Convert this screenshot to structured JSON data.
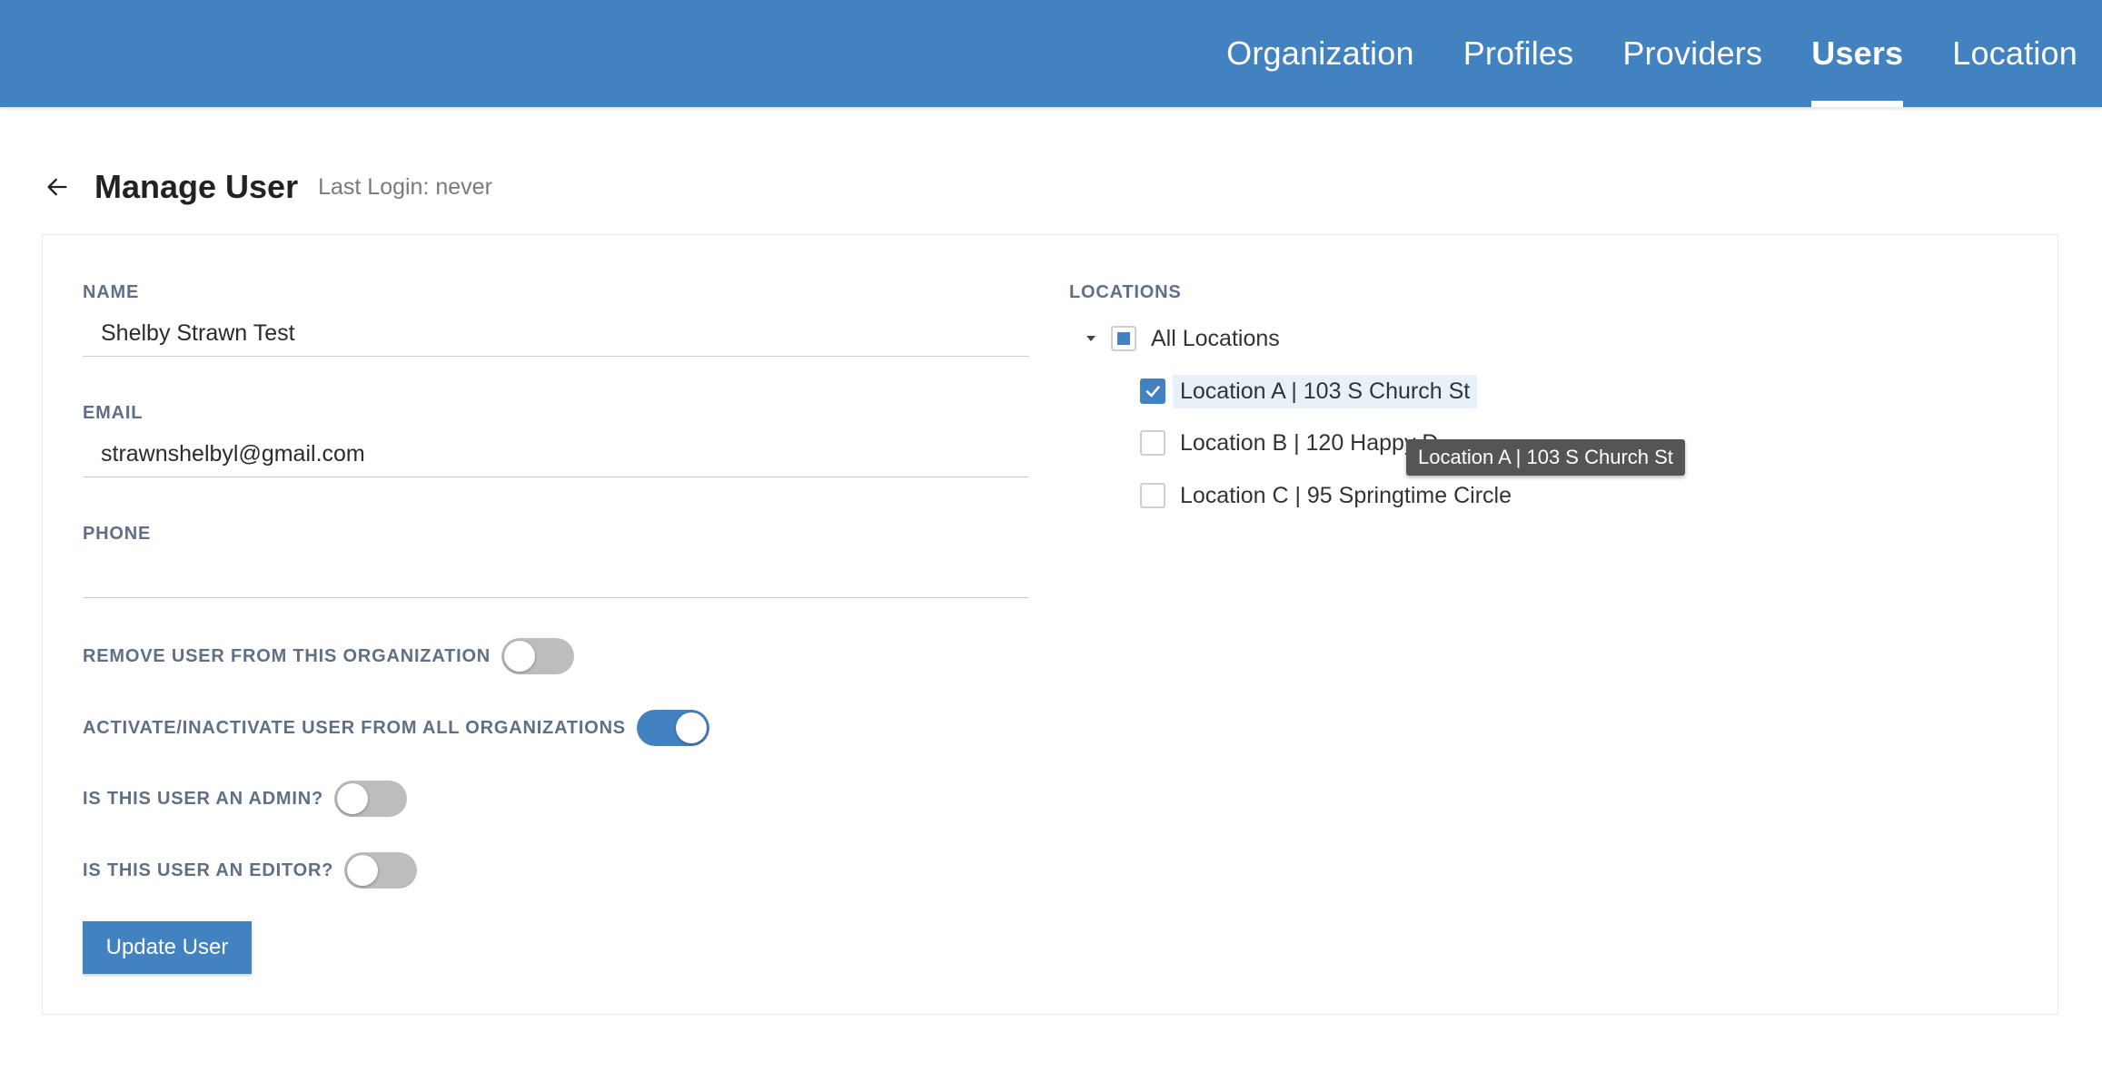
{
  "nav": {
    "items": [
      {
        "label": "Organization",
        "active": false
      },
      {
        "label": "Profiles",
        "active": false
      },
      {
        "label": "Providers",
        "active": false
      },
      {
        "label": "Users",
        "active": true
      },
      {
        "label": "Location",
        "active": false
      }
    ]
  },
  "header": {
    "title": "Manage User",
    "last_login": "Last Login: never",
    "back_icon": "arrow-left-icon"
  },
  "form": {
    "name": {
      "label": "NAME",
      "value": "Shelby Strawn Test"
    },
    "email": {
      "label": "EMAIL",
      "value": "strawnshelbyl@gmail.com"
    },
    "phone": {
      "label": "PHONE",
      "value": ""
    },
    "toggles": [
      {
        "label": "REMOVE USER FROM THIS ORGANIZATION",
        "on": false
      },
      {
        "label": "ACTIVATE/INACTIVATE USER FROM ALL ORGANIZATIONS",
        "on": true
      },
      {
        "label": "IS THIS USER AN ADMIN?",
        "on": false
      },
      {
        "label": "IS THIS USER AN EDITOR?",
        "on": false
      }
    ],
    "submit_label": "Update User"
  },
  "locations": {
    "label": "LOCATIONS",
    "root": {
      "label": "All Locations",
      "state": "partial",
      "expanded": true
    },
    "items": [
      {
        "label": "Location A | 103 S Church St",
        "checked": true
      },
      {
        "label": "Location B | 120 Happy D",
        "checked": false
      },
      {
        "label": "Location C | 95 Springtime Circle",
        "checked": false
      }
    ],
    "tooltip": "Location A | 103 S Church St"
  },
  "colors": {
    "primary": "#4382c0",
    "label": "#5f6f86",
    "toggle_off": "#bdbdbd"
  }
}
